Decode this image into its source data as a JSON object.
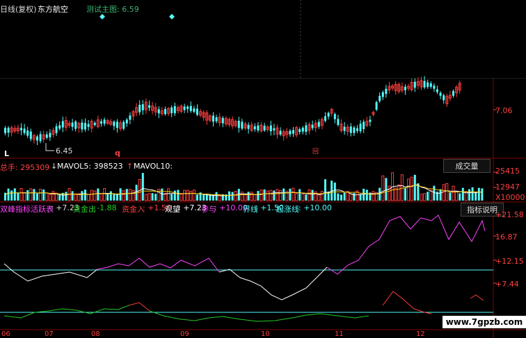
{
  "header": {
    "period_label": "日线(复权)",
    "stock_name": "东方航空",
    "indicator_label": "测试主图: 6.59"
  },
  "main_chart": {
    "price_axis_label": "7.06",
    "low_annotation": "6.45",
    "marker_L": "L",
    "marker_q": "q",
    "marker_block": "回"
  },
  "volume": {
    "total_label": "总手: 295309",
    "mavol5_label": "MAVOL5: 398523",
    "mavol10_label": "MAVOL10:",
    "button_label": "成交量",
    "axis": [
      "25415",
      "12947",
      "X10000"
    ]
  },
  "indicator": {
    "name": "双峰指标",
    "active_label": "活跃表",
    "active_value": ": +7.23",
    "out_label": "资金出",
    "out_value": ": -1.88",
    "in_label": "资金入",
    "in_value": ": +1.50",
    "watch_label": "观望",
    "watch_value": ": +7.23",
    "join_label": "参与",
    "join_value": ": +10.00",
    "bound_label": "界线",
    "bound_value": ": +1.50",
    "rise_label": "起涨线",
    "rise_value": ": +10.00",
    "help_button": "指标说明",
    "axis": [
      "+21.58",
      "16.87",
      "+12.15",
      "+7.44"
    ]
  },
  "time_axis": [
    "06",
    "07",
    "08",
    "09",
    "10",
    "11",
    "12"
  ],
  "watermark": "www.7gpzb.com",
  "colors": {
    "up": "#ff3c3c",
    "down": "#54fcfc",
    "grid": "#800000",
    "magenta": "#ff44ff",
    "green": "#22cc22"
  }
}
